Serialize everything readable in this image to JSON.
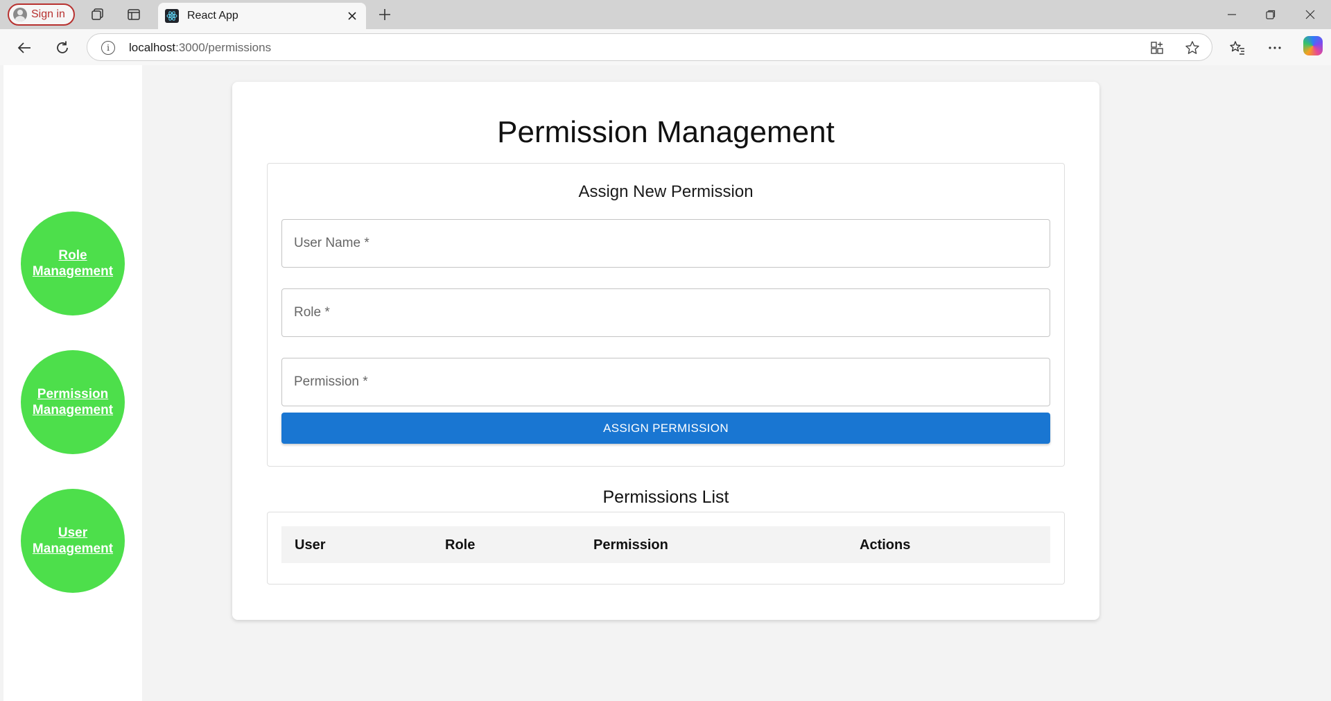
{
  "browser": {
    "signin_label": "Sign in",
    "tab_title": "React App",
    "url_host": "localhost",
    "url_path": ":3000/permissions"
  },
  "sidebar": {
    "items": [
      {
        "line1": "Role",
        "line2": "Management"
      },
      {
        "line1": "Permission",
        "line2": "Management"
      },
      {
        "line1": "User",
        "line2": "Management"
      }
    ]
  },
  "main": {
    "title": "Permission Management",
    "form": {
      "title": "Assign New Permission",
      "user_placeholder": "User Name *",
      "role_placeholder": "Role *",
      "permission_placeholder": "Permission *",
      "submit_label": "ASSIGN PERMISSION"
    },
    "list": {
      "title": "Permissions List",
      "columns": [
        "User",
        "Role",
        "Permission",
        "Actions"
      ],
      "rows": []
    }
  },
  "colors": {
    "nav_circle": "#4ddf4b",
    "primary_button": "#1976d2"
  }
}
